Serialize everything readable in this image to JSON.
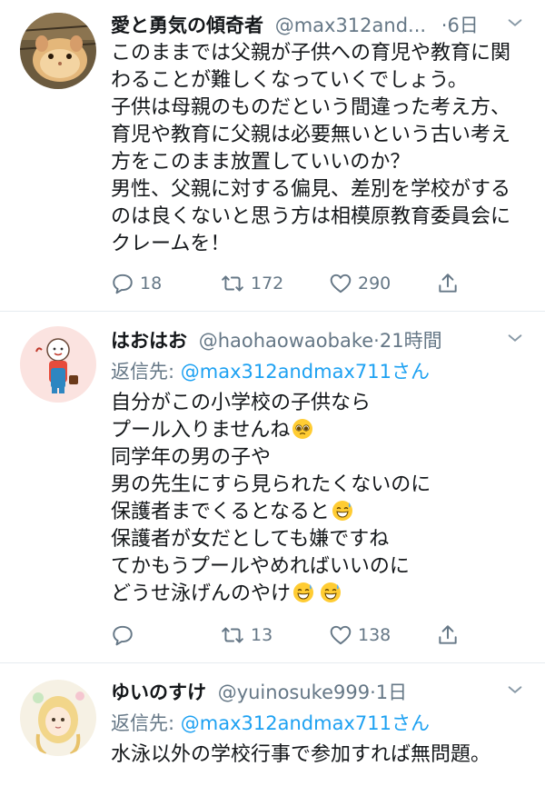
{
  "tweets": [
    {
      "name": "愛と勇気の傾奇者",
      "handle": "@max312and...",
      "sep": "·",
      "time": "6日",
      "lines": [
        "このままでは父親が子供への育児や教育に関",
        "わることが難しくなっていくでしょう。",
        "子供は母親のものだという間違った考え方、",
        "育児や教育に父親は必要無いという古い考え",
        "方をこのまま放置していいのか？",
        "男性、父親に対する偏見、差別を学校がする",
        "のは良くないと思う方は相模原教育委員会に",
        "クレームを！"
      ],
      "replies": "18",
      "retweets": "172",
      "likes": "290"
    },
    {
      "name": "はおはお",
      "handle": "@haohaowaobake",
      "sep": "·",
      "time": "21時間",
      "reply_prefix": "返信先: ",
      "reply_to": "@max312andmax711さん",
      "lines": [
        "自分がこの小学校の子供なら",
        "プール入りませんね",
        "同学年の男の子や",
        "男の先生にすら見られたくないのに",
        "保護者までくるとなると",
        "保護者が女だとしても嫌ですね",
        "てかもうプールやめればいいのに",
        "どうせ泳げんのやけ"
      ],
      "replies": "",
      "retweets": "13",
      "likes": "138"
    },
    {
      "name": "ゆいのすけ",
      "handle": "@yuinosuke999",
      "sep": "·",
      "time": "1日",
      "reply_prefix": "返信先: ",
      "reply_to": "@max312andmax711さん",
      "lines": [
        "水泳以外の学校行事で参加すれば無問題。"
      ]
    }
  ],
  "icons": {
    "caret": "chevron-down-icon",
    "reply": "reply-icon",
    "retweet": "retweet-icon",
    "like": "heart-icon",
    "share": "share-icon",
    "emoji_pleading": "pleading-face-emoji-icon",
    "emoji_sweat": "grinning-sweat-emoji-icon"
  },
  "colors": {
    "text": "#14171a",
    "secondary": "#657786",
    "link": "#1da1f2",
    "divider": "#e6ecf0"
  }
}
